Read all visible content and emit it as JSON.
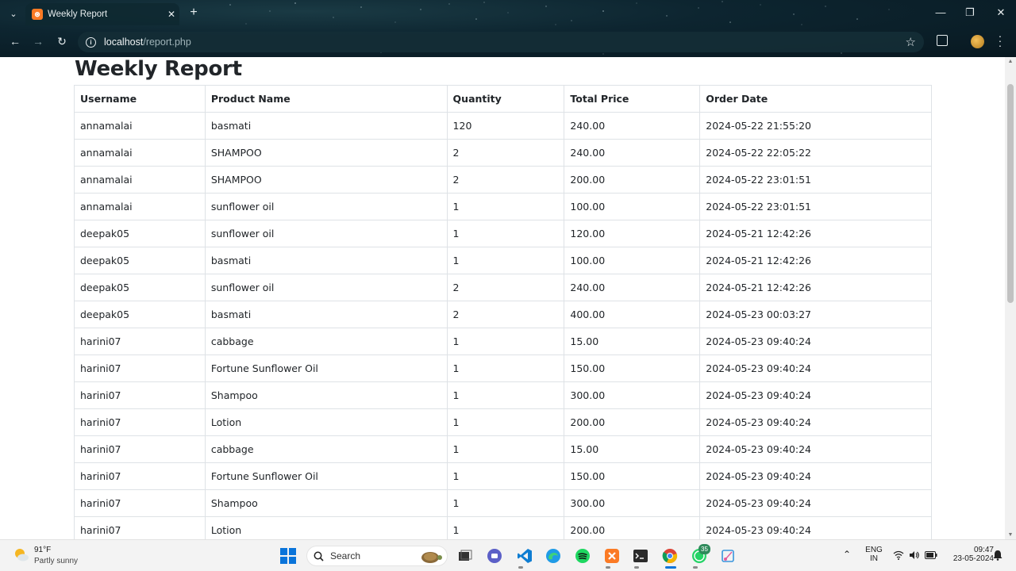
{
  "browser": {
    "tab_title": "Weekly Report",
    "url_host": "localhost",
    "url_path": "/report.php"
  },
  "page": {
    "title": "Weekly Report"
  },
  "table": {
    "headers": [
      "Username",
      "Product Name",
      "Quantity",
      "Total Price",
      "Order Date"
    ],
    "rows": [
      [
        "annamalai",
        "basmati",
        "120",
        "240.00",
        "2024-05-22 21:55:20"
      ],
      [
        "annamalai",
        "SHAMPOO",
        "2",
        "240.00",
        "2024-05-22 22:05:22"
      ],
      [
        "annamalai",
        "SHAMPOO",
        "2",
        "200.00",
        "2024-05-22 23:01:51"
      ],
      [
        "annamalai",
        "sunflower oil",
        "1",
        "100.00",
        "2024-05-22 23:01:51"
      ],
      [
        "deepak05",
        "sunflower oil",
        "1",
        "120.00",
        "2024-05-21 12:42:26"
      ],
      [
        "deepak05",
        "basmati",
        "1",
        "100.00",
        "2024-05-21 12:42:26"
      ],
      [
        "deepak05",
        "sunflower oil",
        "2",
        "240.00",
        "2024-05-21 12:42:26"
      ],
      [
        "deepak05",
        "basmati",
        "2",
        "400.00",
        "2024-05-23 00:03:27"
      ],
      [
        "harini07",
        "cabbage",
        "1",
        "15.00",
        "2024-05-23 09:40:24"
      ],
      [
        "harini07",
        "Fortune Sunflower Oil",
        "1",
        "150.00",
        "2024-05-23 09:40:24"
      ],
      [
        "harini07",
        "Shampoo",
        "1",
        "300.00",
        "2024-05-23 09:40:24"
      ],
      [
        "harini07",
        "Lotion",
        "1",
        "200.00",
        "2024-05-23 09:40:24"
      ],
      [
        "harini07",
        "cabbage",
        "1",
        "15.00",
        "2024-05-23 09:40:24"
      ],
      [
        "harini07",
        "Fortune Sunflower Oil",
        "1",
        "150.00",
        "2024-05-23 09:40:24"
      ],
      [
        "harini07",
        "Shampoo",
        "1",
        "300.00",
        "2024-05-23 09:40:24"
      ],
      [
        "harini07",
        "Lotion",
        "1",
        "200.00",
        "2024-05-23 09:40:24"
      ]
    ]
  },
  "taskbar": {
    "weather_temp": "91°F",
    "weather_desc": "Partly sunny",
    "search_label": "Search",
    "whatsapp_badge": "35",
    "lang_top": "ENG",
    "lang_bottom": "IN",
    "time": "09:47",
    "date": "23-05-2024"
  },
  "colors": {
    "chrome_bg": "#0d2530",
    "table_border": "#dee2e6",
    "text": "#212529"
  }
}
